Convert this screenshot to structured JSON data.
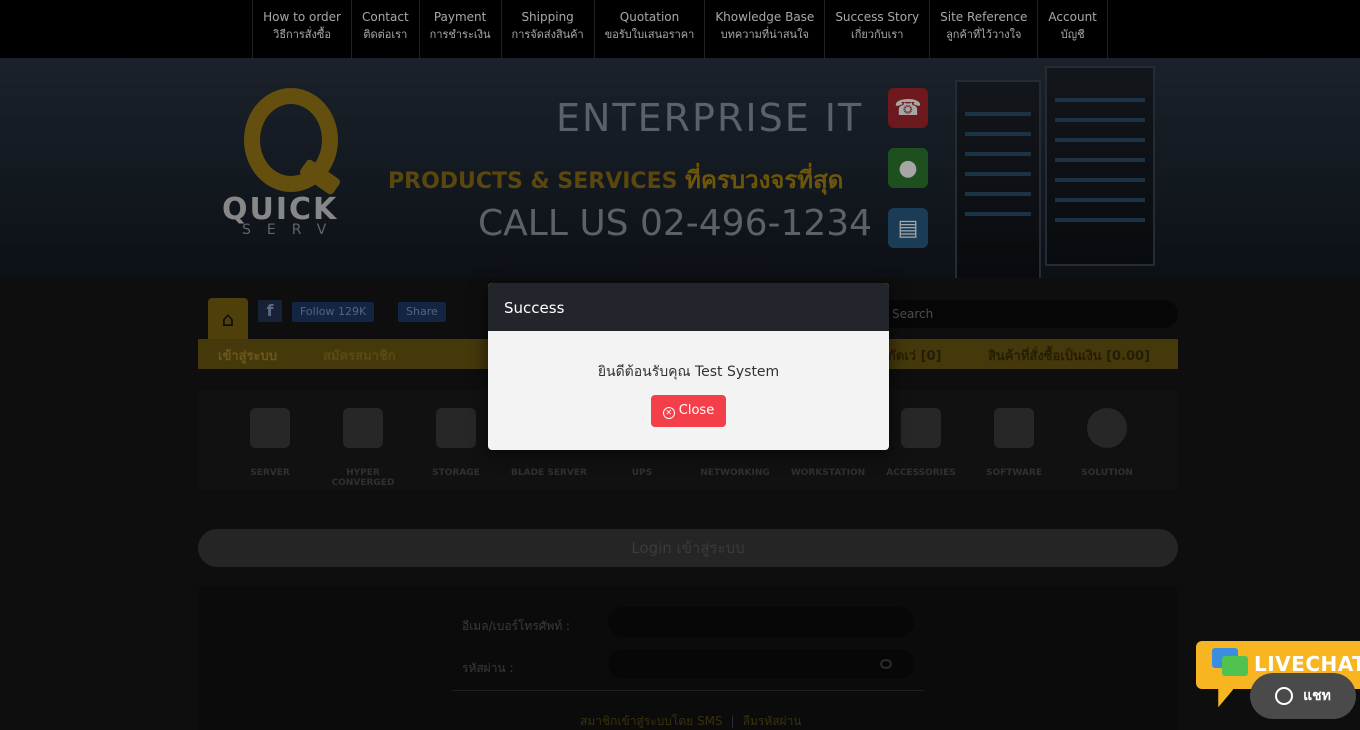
{
  "nav": [
    {
      "en": "How to order",
      "th": "วิธีการสั่งซื้อ"
    },
    {
      "en": "Contact",
      "th": "ติดต่อเรา"
    },
    {
      "en": "Payment",
      "th": "การชำระเงิน"
    },
    {
      "en": "Shipping",
      "th": "การจัดส่งสินค้า"
    },
    {
      "en": "Quotation",
      "th": "ขอรับใบเสนอราคา"
    },
    {
      "en": "Khowledge Base",
      "th": "บทความที่น่าสนใจ"
    },
    {
      "en": "Success Story",
      "th": "เกี่ยวกับเรา"
    },
    {
      "en": "Site Reference",
      "th": "ลูกค้าที่ไว้วางใจ"
    },
    {
      "en": "Account",
      "th": "บัญชี"
    }
  ],
  "banner": {
    "logo_text": "QUICK",
    "logo_sub": "SERV",
    "line1": "ENTERPRISE IT",
    "line2_en": "PRODUCTS & SERVICES",
    "line2_th": "ที่ครบวงจรที่สุด",
    "line3": "CALL US  02-496-1234"
  },
  "social": {
    "fb_letter": "f",
    "follow": "Follow 129K",
    "share": "Share"
  },
  "search": {
    "placeholder": "Search"
  },
  "menu": {
    "login": "เข้าสู่ระบบ",
    "register": "สมัครสมาชิก",
    "cart": "กัดเว่ [0]",
    "total": "สินค้าที่สั่งซื้อเป็นเงิน [0.00]"
  },
  "categories": [
    "SERVER",
    "HYPER CONVERGED",
    "STORAGE",
    "BLADE SERVER",
    "UPS",
    "NETWORKING",
    "WORKSTATION",
    "ACCESSORIES",
    "SOFTWARE",
    "SOLUTION"
  ],
  "login": {
    "title": "Login เข้าสู่ระบบ",
    "email_label": "อีเมล/เบอร์โทรศัพท์ :",
    "password_label": "รหัสผ่าน :",
    "sms_link": "สมาชิกเข้าสู่ระบบโดย SMS",
    "separator": "|",
    "forgot_link": "ลืมรหัสผ่าน"
  },
  "modal": {
    "title": "Success",
    "message": "ยินดีต้อนรับคุณ Test System",
    "close_label": "Close"
  },
  "livechat": {
    "label": "LIVECHAT",
    "chat_label": "แชท"
  },
  "colors": {
    "accent_gold": "#9c7a16",
    "close_red": "#f23f4a",
    "livechat_yellow": "#f6b521"
  }
}
